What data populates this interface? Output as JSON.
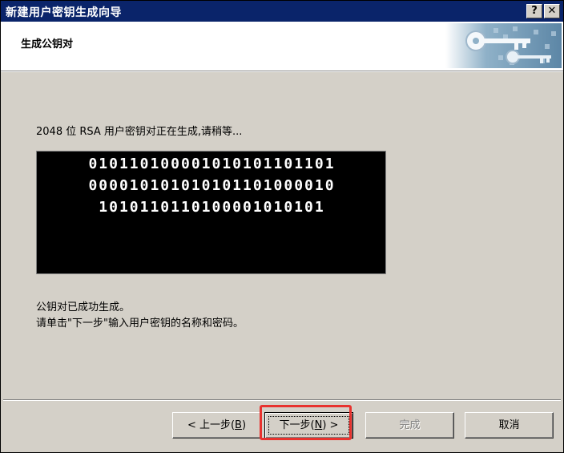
{
  "window": {
    "title": "新建用户密钥生成向导",
    "help_button": "?",
    "close_button": "✕"
  },
  "header": {
    "title": "生成公钥对",
    "art_icon": "keys-icon"
  },
  "main": {
    "status_text": "2048 位 RSA 用户密钥对正在生成,请稍等...",
    "bits_lines": [
      "010110100001010101101101",
      "000010101010101101000010",
      "1010110110100001010101"
    ],
    "message_line1": "公钥对已成功生成。",
    "message_line2": "请单击\"下一步\"输入用户密钥的名称和密码。"
  },
  "buttons": {
    "back_pre": "< 上一步(",
    "back_key": "B",
    "back_post": ")",
    "next_pre": "下一步(",
    "next_key": "N",
    "next_post": ") >",
    "finish": "完成",
    "cancel": "取消"
  },
  "colors": {
    "titlebar": "#0a246a",
    "highlight_box": "#e8322e"
  }
}
